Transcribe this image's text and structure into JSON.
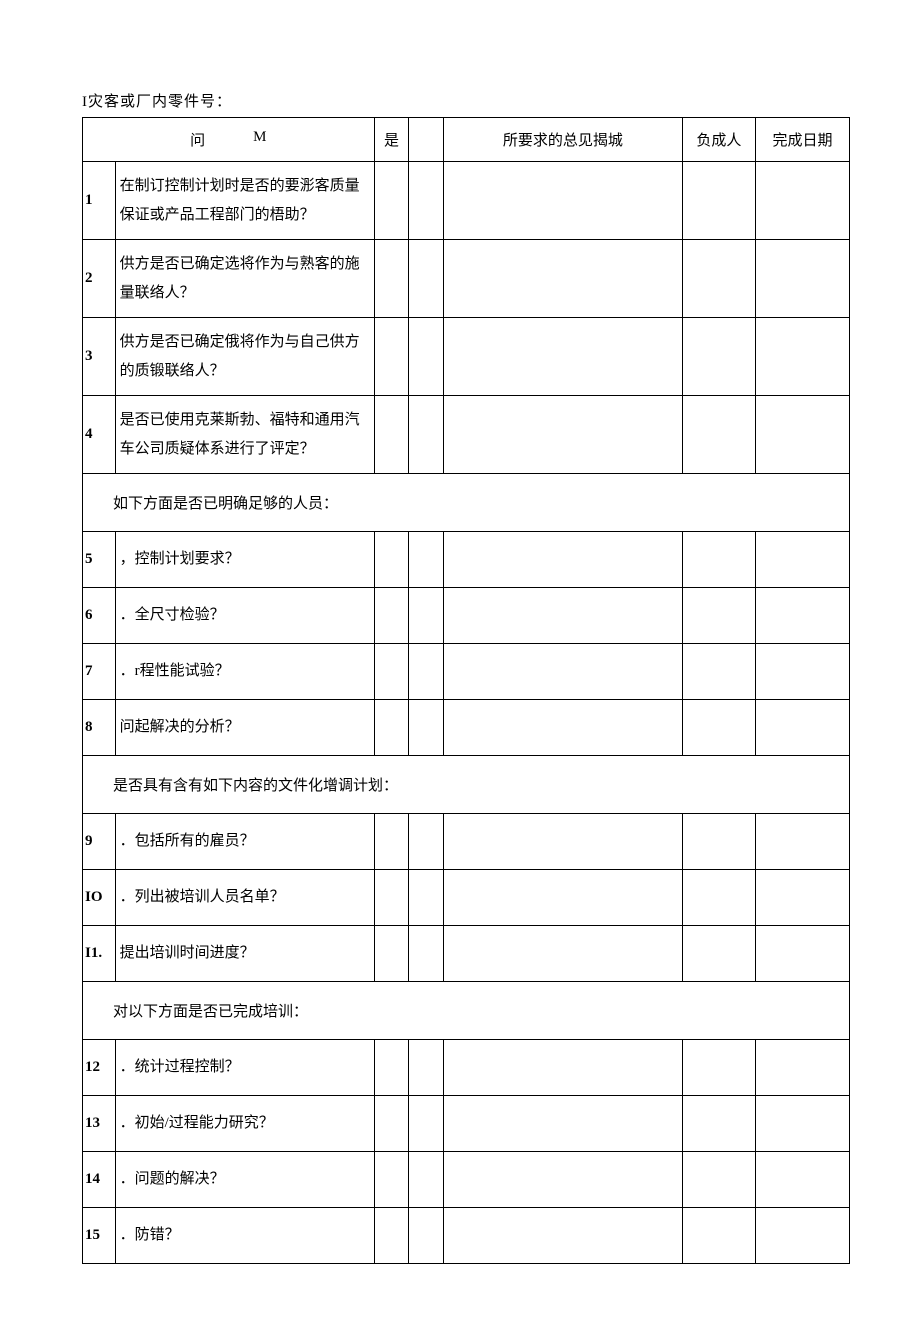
{
  "topLabel": "I灾客或厂内零件号：",
  "header": {
    "question_a": "问",
    "question_b": "M",
    "yes": "是",
    "no": "",
    "opinion": "所要求的总见揭城",
    "owner": "负成人",
    "dueDate": "完成日期"
  },
  "rows": [
    {
      "n": "1",
      "q": "在制订控制计划时是否的要浵客质量保证或产品工程部门的梧助？"
    },
    {
      "n": "2",
      "q": "供方是否已确定选将作为与熟客的施量联络人？"
    },
    {
      "n": "3",
      "q": "供方是否已确定俄将作为与自己供方的质锻联络人？"
    },
    {
      "n": "4",
      "q": "是否已使用克莱斯勃、福特和通用汽车公司质疑体系进行了评定？"
    },
    {
      "section": "如下方面是否已明确足够的人员："
    },
    {
      "n": "5",
      "q": "，控制计划要求？",
      "tall": true
    },
    {
      "n": "6",
      "q": "．全尺寸检验？",
      "tall": true
    },
    {
      "n": "7",
      "q": "．r程性能试验？",
      "tall": true
    },
    {
      "n": "8",
      "q": "问起解决的分析？",
      "tall": true
    },
    {
      "section": "是否具有含有如下内容的文件化增调计划："
    },
    {
      "n": "9",
      "q": "．包括所有的雇员？",
      "tall": true
    },
    {
      "n": "IO",
      "q": "．列出被培训人员名单？",
      "tall": true
    },
    {
      "n": "I1.",
      "q": "提出培训时间进度？",
      "tall": true
    },
    {
      "section": "对以下方面是否已完成培训："
    },
    {
      "n": "12",
      "q": "．统计过程控制？",
      "tall": true
    },
    {
      "n": "13",
      "q": "．初始/过程能力研究？",
      "tall": true
    },
    {
      "n": "14",
      "q": "．问题的解决？",
      "tall": true
    },
    {
      "n": "15",
      "q": "．防错？",
      "tall": true
    }
  ]
}
